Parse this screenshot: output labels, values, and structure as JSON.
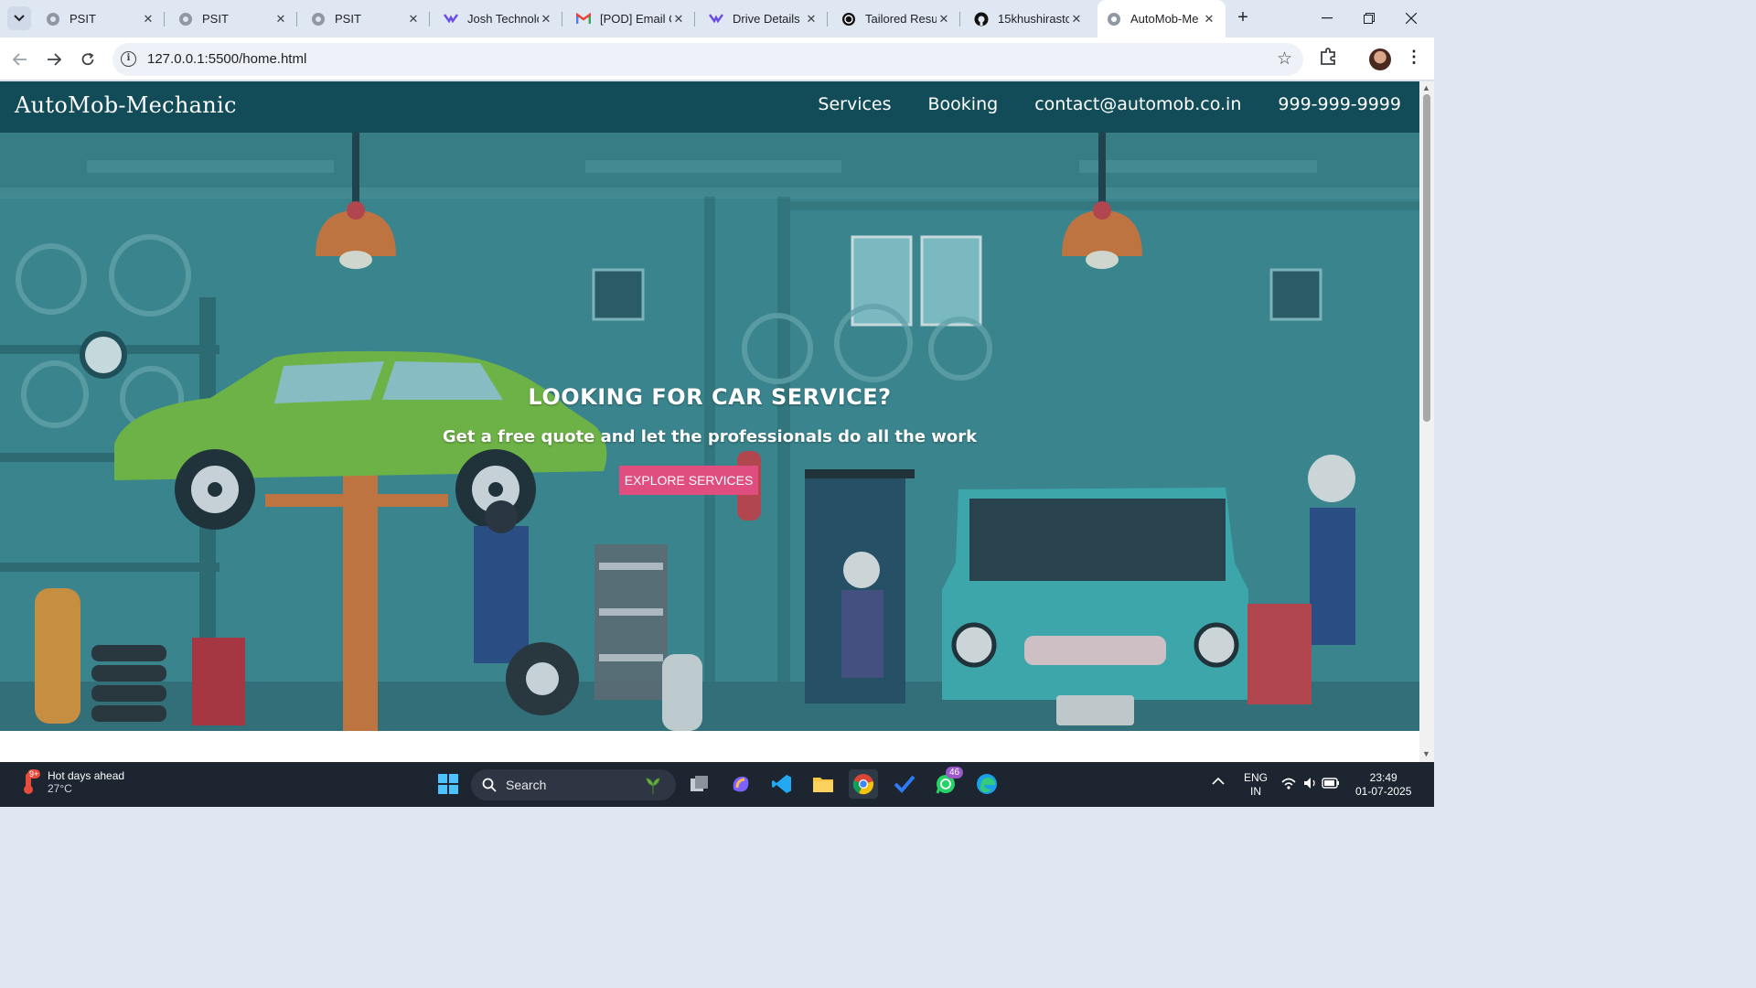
{
  "browser": {
    "tabs": [
      {
        "title": "PSIT",
        "icon": "globe-icon"
      },
      {
        "title": "PSIT",
        "icon": "globe-icon"
      },
      {
        "title": "PSIT",
        "icon": "globe-icon"
      },
      {
        "title": "Josh Technolo",
        "icon": "josh-logo-icon"
      },
      {
        "title": "[POD] Email C",
        "icon": "gmail-icon"
      },
      {
        "title": "Drive Details",
        "icon": "josh-logo-icon"
      },
      {
        "title": "Tailored Resu",
        "icon": "openai-icon"
      },
      {
        "title": "15khushirasto",
        "icon": "github-icon"
      },
      {
        "title": "AutoMob-Me",
        "icon": "globe-icon",
        "active": true
      }
    ],
    "url": "127.0.0.1:5500/home.html"
  },
  "site": {
    "brand": "AutoMob-Mechanic",
    "nav": {
      "services": "Services",
      "booking": "Booking",
      "email": "contact@automob.co.in",
      "phone": "999-999-9999"
    },
    "hero": {
      "title": "LOOKING FOR CAR SERVICE?",
      "subtitle": "Get a free quote and let the professionals do all the work",
      "cta": "EXPLORE SERVICES"
    },
    "colors": {
      "navbar": "#124c58",
      "cta": "#e04d7f",
      "hero_bg": "#3f8e96"
    }
  },
  "taskbar": {
    "weather_title": "Hot days ahead",
    "weather_temp": "27°C",
    "weather_badge": "9+",
    "search_label": "Search",
    "whatsapp_badge": "46",
    "lang_line1": "ENG",
    "lang_line2": "IN",
    "time": "23:49",
    "date": "01-07-2025"
  }
}
